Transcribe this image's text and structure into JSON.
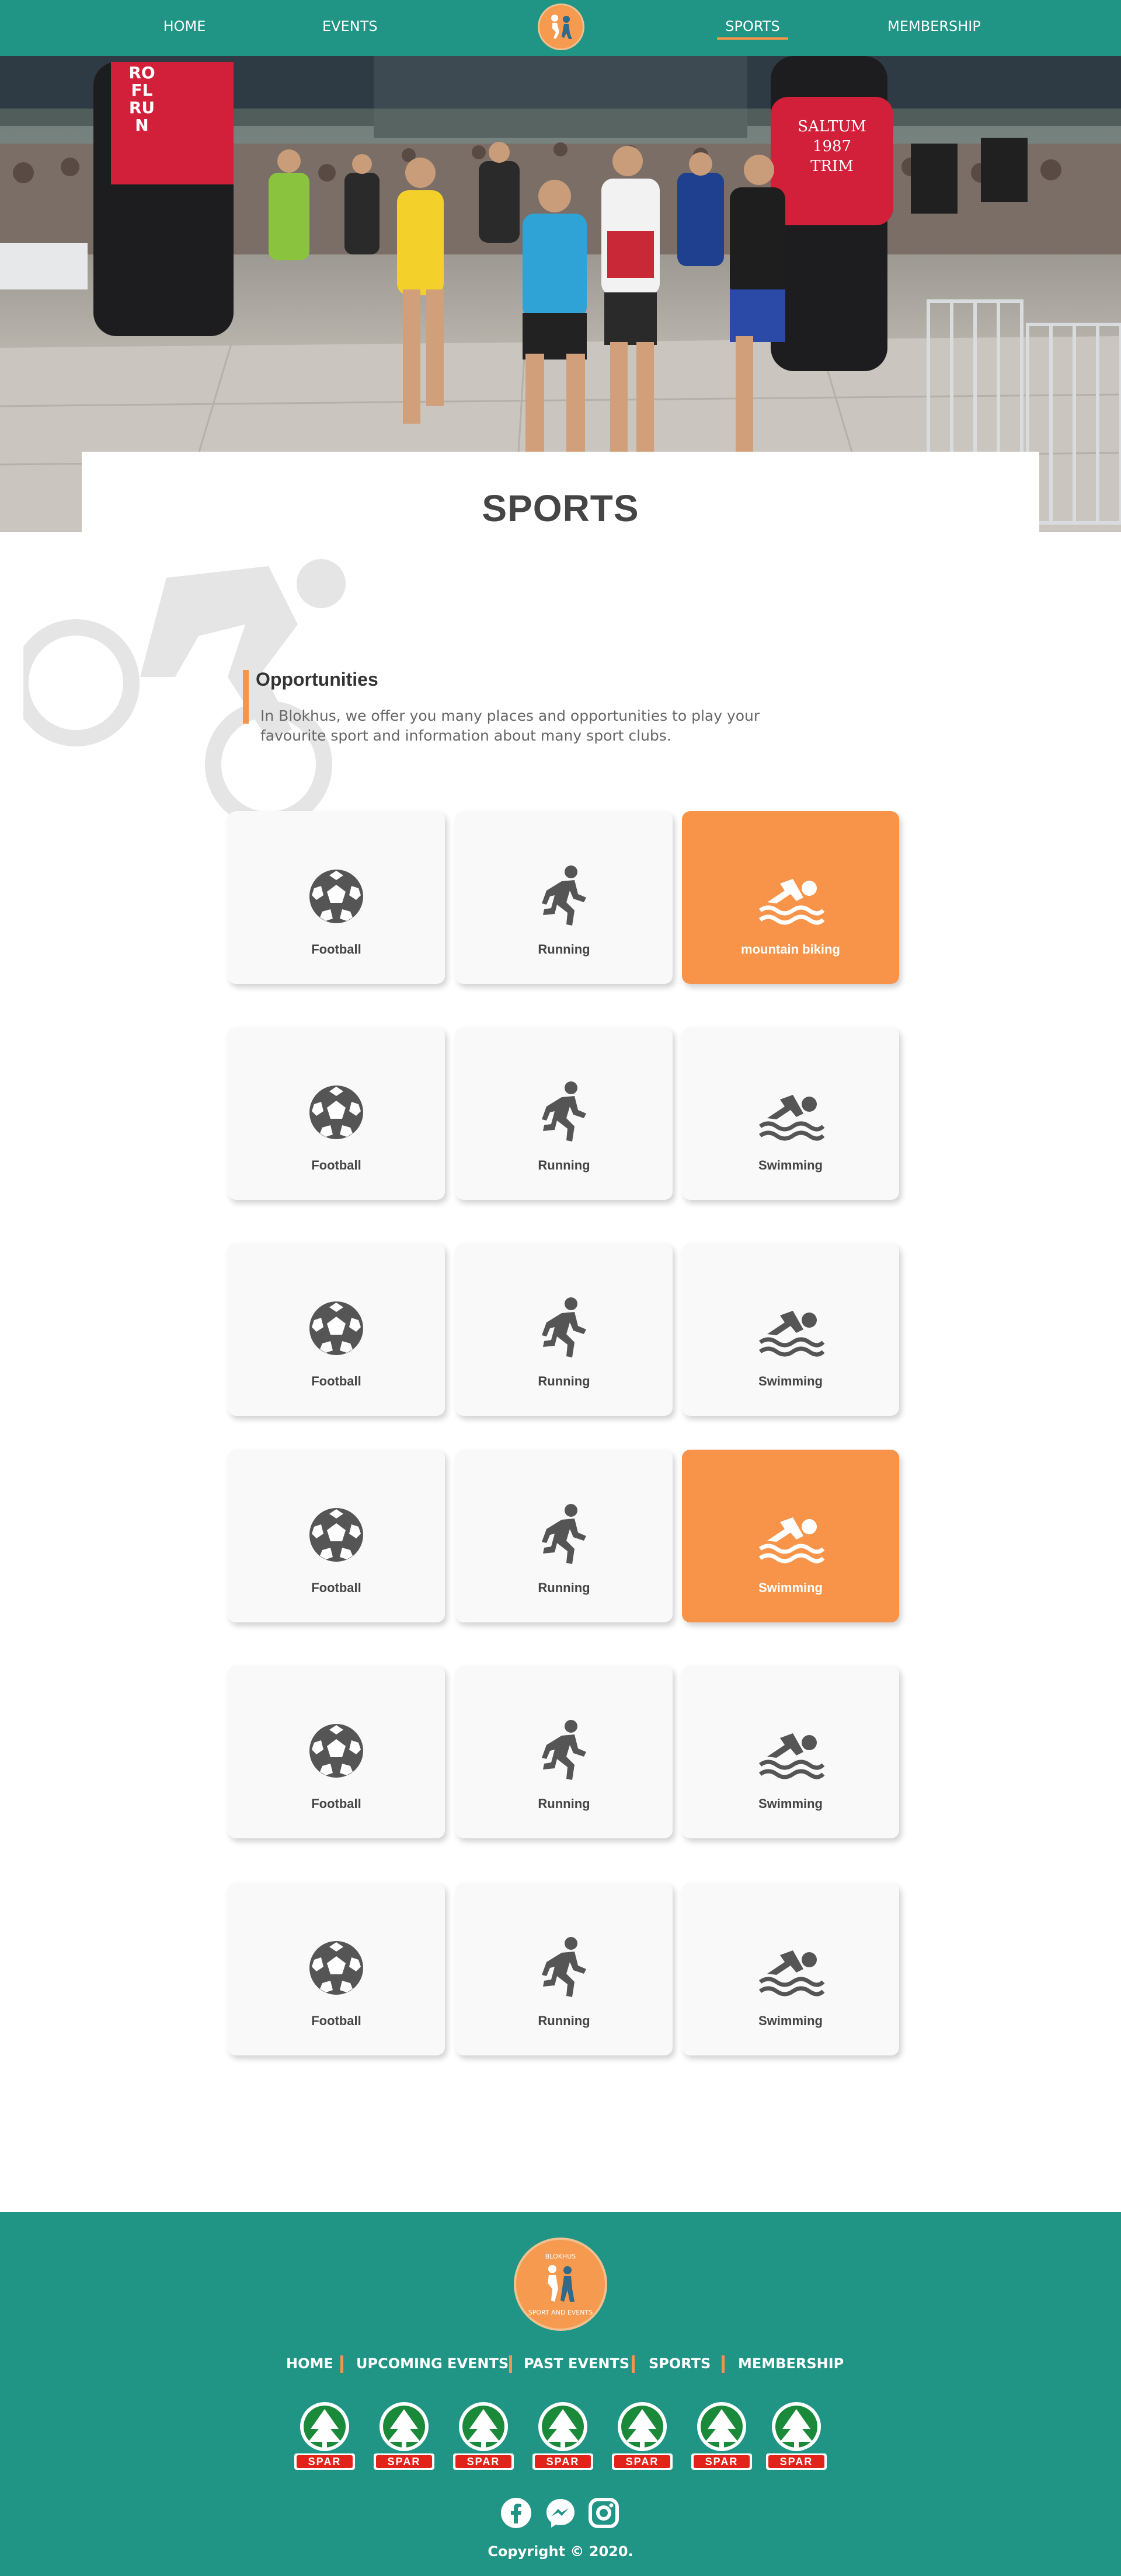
{
  "nav": {
    "items": [
      {
        "label": "HOME",
        "active": false
      },
      {
        "label": "EVENTS",
        "active": false
      },
      {
        "label": "SPORTS",
        "active": true
      },
      {
        "label": "MEMBERSHIP",
        "active": false
      }
    ]
  },
  "hero": {
    "title": "SPORTS",
    "banner_left_text": "ROFL RUN",
    "banner_right_text": "SALTUM 1987 TRIM"
  },
  "opportunities": {
    "title": "Opportunities",
    "text": "In Blokhus, we offer you many places and opportunities to play your favourite sport and information about many sport clubs."
  },
  "sports_grid": {
    "rows": [
      [
        {
          "label": "Football",
          "icon": "soccer-ball-icon",
          "active": false
        },
        {
          "label": "Running",
          "icon": "runner-icon",
          "active": false
        },
        {
          "label": "mountain biking",
          "icon": "swimmer-icon",
          "active": true
        }
      ],
      [
        {
          "label": "Football",
          "icon": "soccer-ball-icon",
          "active": false
        },
        {
          "label": "Running",
          "icon": "runner-icon",
          "active": false
        },
        {
          "label": "Swimming",
          "icon": "swimmer-icon",
          "active": false
        }
      ],
      [
        {
          "label": "Football",
          "icon": "soccer-ball-icon",
          "active": false
        },
        {
          "label": "Running",
          "icon": "runner-icon",
          "active": false
        },
        {
          "label": "Swimming",
          "icon": "swimmer-icon",
          "active": false
        }
      ],
      [
        {
          "label": "Football",
          "icon": "soccer-ball-icon",
          "active": false
        },
        {
          "label": "Running",
          "icon": "runner-icon",
          "active": false
        },
        {
          "label": "Swimming",
          "icon": "swimmer-icon",
          "active": true
        }
      ],
      [
        {
          "label": "Football",
          "icon": "soccer-ball-icon",
          "active": false
        },
        {
          "label": "Running",
          "icon": "runner-icon",
          "active": false
        },
        {
          "label": "Swimming",
          "icon": "swimmer-icon",
          "active": false
        }
      ],
      [
        {
          "label": "Football",
          "icon": "soccer-ball-icon",
          "active": false
        },
        {
          "label": "Running",
          "icon": "runner-icon",
          "active": false
        },
        {
          "label": "Swimming",
          "icon": "swimmer-icon",
          "active": false
        }
      ]
    ]
  },
  "footer": {
    "logo_text_top": "BLOKHUS",
    "logo_text_bottom": "SPORT AND EVENTS",
    "links": [
      "HOME",
      "UPCOMING EVENTS",
      "PAST EVENTS",
      "SPORTS",
      "MEMBERSHIP"
    ],
    "sponsor_name": "SPAR",
    "sponsor_count": 7,
    "social_icons": [
      "facebook-icon",
      "messenger-icon",
      "instagram-icon"
    ],
    "copyright": "Copyright © 2020."
  },
  "colors": {
    "teal": "#209485",
    "orange": "#f7944a",
    "card_bg": "#f9f9f9",
    "icon_gray": "#555555",
    "spar_green": "#1a8a3a",
    "spar_red": "#e2231a"
  }
}
